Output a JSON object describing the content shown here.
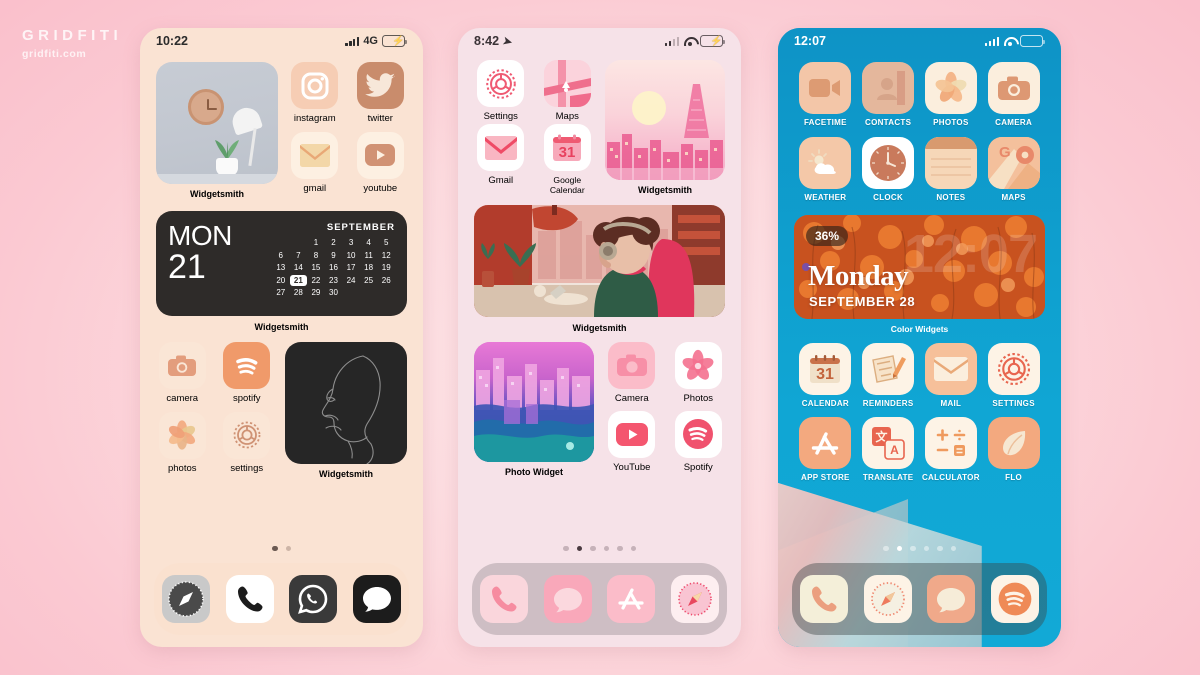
{
  "watermark": {
    "brand": "GRIDFITI",
    "site": "gridfiti.com"
  },
  "phones": [
    {
      "id": "phone1",
      "theme_name": "peach-aesthetic",
      "bg_color": "#fae3d3",
      "status": {
        "time": "10:22",
        "network": "4G",
        "battery_state": "charging",
        "has_wifi": false,
        "has_location": false
      },
      "widgets": {
        "photo_widget_label": "Widgetsmith",
        "calendar": {
          "weekday": "MON",
          "day": "21",
          "month": "SEPTEMBER",
          "days": [
            "",
            "",
            "1",
            "2",
            "3",
            "4",
            "5",
            "6",
            "7",
            "8",
            "9",
            "10",
            "11",
            "12",
            "13",
            "14",
            "15",
            "16",
            "17",
            "18",
            "19",
            "20",
            "21",
            "22",
            "23",
            "24",
            "25",
            "26",
            "27",
            "28",
            "29",
            "30",
            "",
            "",
            ""
          ],
          "highlight": "21",
          "label": "Widgetsmith"
        },
        "face_widget_label": "Widgetsmith"
      },
      "apps_top": [
        {
          "label": "instagram",
          "icon": "instagram-icon"
        },
        {
          "label": "twitter",
          "icon": "twitter-icon"
        },
        {
          "label": "gmail",
          "icon": "gmail-icon"
        },
        {
          "label": "youtube",
          "icon": "youtube-icon"
        }
      ],
      "apps_bottom": [
        {
          "label": "camera",
          "icon": "camera-icon"
        },
        {
          "label": "spotify",
          "icon": "spotify-icon"
        },
        {
          "label": "photos",
          "icon": "photos-flower-icon"
        },
        {
          "label": "settings",
          "icon": "settings-gear-icon"
        }
      ],
      "page_dots": {
        "count": 2,
        "active": 0
      },
      "dock": [
        {
          "label": "Safari",
          "icon": "safari-compass-icon"
        },
        {
          "label": "Phone",
          "icon": "phone-handset-icon"
        },
        {
          "label": "WhatsApp",
          "icon": "whatsapp-icon"
        },
        {
          "label": "Messages",
          "icon": "messages-bubble-icon"
        }
      ]
    },
    {
      "id": "phone2",
      "theme_name": "pink-aesthetic",
      "bg_color": "#f6e2e8",
      "status": {
        "time": "8:42",
        "network": "",
        "battery_state": "charging",
        "has_wifi": true,
        "has_location": true
      },
      "widgets": {
        "tokyo_widget_label": "Widgetsmith",
        "lofi_widget_label": "Widgetsmith",
        "photo_widget_label": "Photo Widget"
      },
      "apps_top": [
        {
          "label": "Settings",
          "icon": "settings-gear-icon"
        },
        {
          "label": "Maps",
          "icon": "maps-icon"
        },
        {
          "label": "Gmail",
          "icon": "gmail-icon"
        },
        {
          "label": "Google Calendar",
          "icon": "google-calendar-icon",
          "day": "31"
        }
      ],
      "apps_bottom": [
        {
          "label": "Camera",
          "icon": "camera-icon"
        },
        {
          "label": "Photos",
          "icon": "photos-flower-icon"
        },
        {
          "label": "YouTube",
          "icon": "youtube-icon"
        },
        {
          "label": "Spotify",
          "icon": "spotify-icon"
        }
      ],
      "page_dots": {
        "count": 6,
        "active": 1
      },
      "dock": [
        {
          "label": "Phone",
          "icon": "phone-handset-icon"
        },
        {
          "label": "Messages",
          "icon": "messages-bubble-icon"
        },
        {
          "label": "App Store",
          "icon": "app-store-icon"
        },
        {
          "label": "Safari",
          "icon": "safari-compass-icon"
        }
      ]
    },
    {
      "id": "phone3",
      "theme_name": "blue-orange-aesthetic",
      "bg_color": "#10a0d0",
      "status": {
        "time": "12:07",
        "network": "",
        "battery_state": "low",
        "has_wifi": true,
        "has_location": false
      },
      "widgets": {
        "color_widget": {
          "battery_percent": "36%",
          "ghost_time": "12:07",
          "weekday": "Monday",
          "date": "SEPTEMBER 28",
          "label": "Color Widgets"
        }
      },
      "apps_row1": [
        {
          "label": "FACETIME",
          "icon": "facetime-icon"
        },
        {
          "label": "CONTACTS",
          "icon": "contacts-icon"
        },
        {
          "label": "PHOTOS",
          "icon": "photos-flower-icon"
        },
        {
          "label": "CAMERA",
          "icon": "camera-icon"
        }
      ],
      "apps_row2": [
        {
          "label": "WEATHER",
          "icon": "weather-sun-cloud-icon"
        },
        {
          "label": "CLOCK",
          "icon": "clock-icon"
        },
        {
          "label": "NOTES",
          "icon": "notes-icon"
        },
        {
          "label": "MAPS",
          "icon": "google-maps-pin-icon"
        }
      ],
      "apps_row3": [
        {
          "label": "CALENDAR",
          "icon": "calendar-icon",
          "day": "31"
        },
        {
          "label": "REMINDERS",
          "icon": "reminders-pencil-icon"
        },
        {
          "label": "MAIL",
          "icon": "mail-envelope-icon"
        },
        {
          "label": "SETTINGS",
          "icon": "settings-gear-icon"
        }
      ],
      "apps_row4": [
        {
          "label": "APP STORE",
          "icon": "app-store-icon"
        },
        {
          "label": "TRANSLATE",
          "icon": "translate-icon"
        },
        {
          "label": "CALCULATOR",
          "icon": "calculator-icon"
        },
        {
          "label": "FLO",
          "icon": "flo-leaf-icon"
        }
      ],
      "page_dots": {
        "count": 6,
        "active": 1
      },
      "dock": [
        {
          "label": "Phone",
          "icon": "phone-handset-icon"
        },
        {
          "label": "Safari",
          "icon": "safari-compass-icon"
        },
        {
          "label": "Messages",
          "icon": "messages-bubble-icon"
        },
        {
          "label": "Spotify",
          "icon": "spotify-icon"
        }
      ]
    }
  ],
  "colors": {
    "bg_pink": "#fbc9d2",
    "peach": "#fae3d3",
    "peach_icon": "#e8a882",
    "pink_accent": "#f4697f",
    "blue": "#10a0d0",
    "orange": "#e8783a"
  }
}
